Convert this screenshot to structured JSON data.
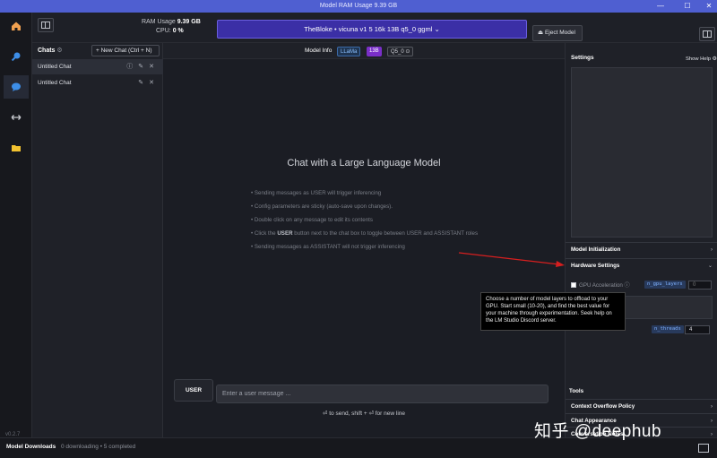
{
  "window": {
    "title": "Model RAM Usage   9.39 GB",
    "minimize": "—",
    "maximize": "☐",
    "close": "✕"
  },
  "header": {
    "ram_label": "RAM Usage",
    "ram_value": "9.39 GB",
    "cpu_label": "CPU:",
    "cpu_value": "0 %",
    "model_selector": "TheBloke • vicuna v1 5 16k 13B q5_0 ggml ⌄",
    "eject_label": "Eject Model"
  },
  "rail": {
    "items": [
      "home-icon",
      "search-icon",
      "chat-icon",
      "arrows-icon",
      "folder-icon"
    ],
    "version": "v0.2.7"
  },
  "chats": {
    "title": "Chats",
    "new_chat": "+ New Chat  (Ctrl + N)",
    "items": [
      {
        "label": "Untitled Chat",
        "active": true
      },
      {
        "label": "Untitled Chat",
        "active": false
      }
    ]
  },
  "model_info": {
    "label": "Model Info",
    "tags": [
      "LLaMa",
      "13B",
      "Q5_0"
    ]
  },
  "chat": {
    "title": "Chat with a Large Language Model",
    "tips": [
      "• Sending messages as USER will trigger inferencing",
      "• Config parameters are sticky (auto-save upon changes).",
      "• Double click on any message to edit its contents",
      "• Click the ",
      "• Sending messages as ASSISTANT will not trigger inferencing"
    ],
    "tip4_bold": "USER",
    "tip4_rest": " button next to the chat box to toggle between USER and ASSISTANT roles",
    "user_button": "USER",
    "input_placeholder": "Enter a user message ...",
    "send_hint": "⏎ to send, shift + ⏎ for new line"
  },
  "settings": {
    "title": "Settings",
    "show_help": "Show Help ⚙",
    "sections": {
      "model_init": "Model Initialization",
      "hardware": "Hardware Settings",
      "tools": "Tools",
      "context_overflow": "Context Overflow Policy",
      "chat_appearance": "Chat Appearance",
      "conversation_notes": "Conversation Notes"
    },
    "gpu_label": "GPU Acceleration ⓘ",
    "gpu_layers_tag": "n_gpu_layers",
    "gpu_layers_value": "0",
    "threads_tag": "n_threads",
    "threads_value": "4"
  },
  "tooltip": "Choose a number of model layers to offload to your GPU. Start small (10-20), and find the best value for your machine through experimentation. Seek help on the LM Studio Discord server.",
  "status": {
    "downloads_label": "Model Downloads",
    "downloads_status": "0 downloading • 5 completed"
  },
  "watermark": "知乎 @deephub",
  "colors": {
    "accent": "#4f5fd1",
    "model_selector": "#3b2fa6",
    "annotation_arrow": "#d61f1f"
  }
}
